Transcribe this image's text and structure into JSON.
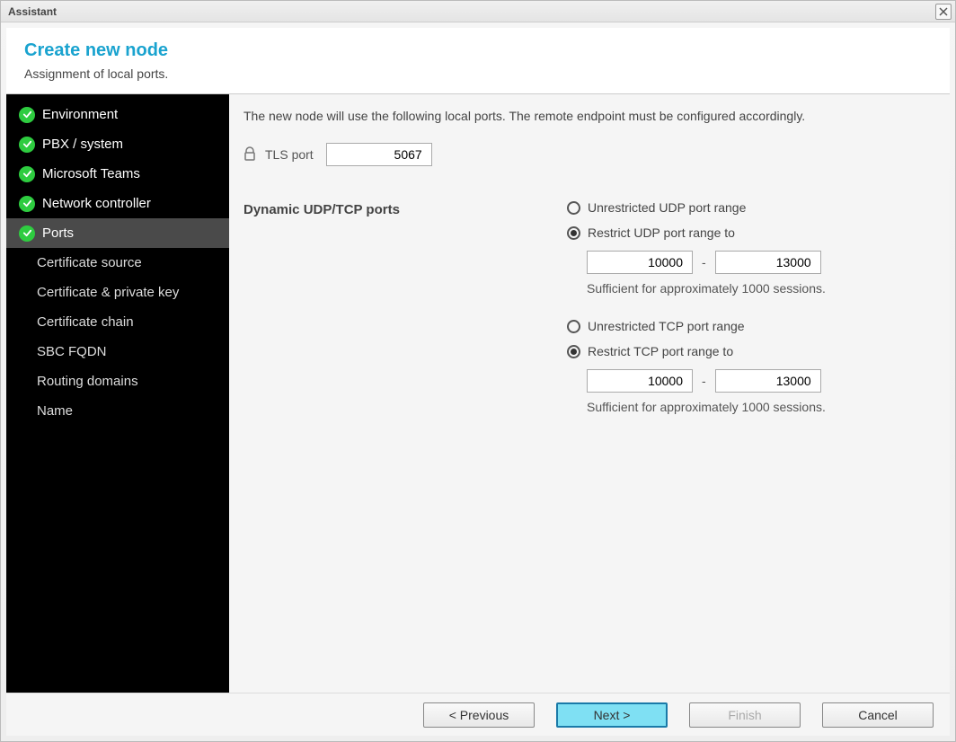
{
  "window_title": "Assistant",
  "header": {
    "title": "Create new node",
    "subtitle": "Assignment of local ports."
  },
  "sidebar": {
    "items": [
      {
        "label": "Environment",
        "completed": true,
        "active": false
      },
      {
        "label": "PBX / system",
        "completed": true,
        "active": false
      },
      {
        "label": "Microsoft Teams",
        "completed": true,
        "active": false
      },
      {
        "label": "Network controller",
        "completed": true,
        "active": false
      },
      {
        "label": "Ports",
        "completed": true,
        "active": true
      },
      {
        "label": "Certificate source",
        "completed": false,
        "active": false,
        "sub": true
      },
      {
        "label": "Certificate & private key",
        "completed": false,
        "active": false,
        "sub": true
      },
      {
        "label": "Certificate chain",
        "completed": false,
        "active": false,
        "sub": true
      },
      {
        "label": "SBC FQDN",
        "completed": false,
        "active": false,
        "sub": true
      },
      {
        "label": "Routing domains",
        "completed": false,
        "active": false,
        "sub": true
      },
      {
        "label": "Name",
        "completed": false,
        "active": false,
        "sub": true
      }
    ]
  },
  "content": {
    "intro": "The new node will use the following local ports. The remote endpoint must be configured accordingly.",
    "tls": {
      "label": "TLS port",
      "value": "5067"
    },
    "dyn_section_label": "Dynamic UDP/TCP ports",
    "udp": {
      "unrestricted_label": "Unrestricted UDP port range",
      "restrict_label": "Restrict UDP port range to",
      "selected": "restrict",
      "from": "10000",
      "to": "13000",
      "hint": "Sufficient for approximately 1000 sessions."
    },
    "tcp": {
      "unrestricted_label": "Unrestricted TCP port range",
      "restrict_label": "Restrict TCP port range to",
      "selected": "restrict",
      "from": "10000",
      "to": "13000",
      "hint": "Sufficient for approximately 1000 sessions."
    },
    "range_sep": "-"
  },
  "footer": {
    "previous": "< Previous",
    "next": "Next >",
    "finish": "Finish",
    "cancel": "Cancel"
  }
}
